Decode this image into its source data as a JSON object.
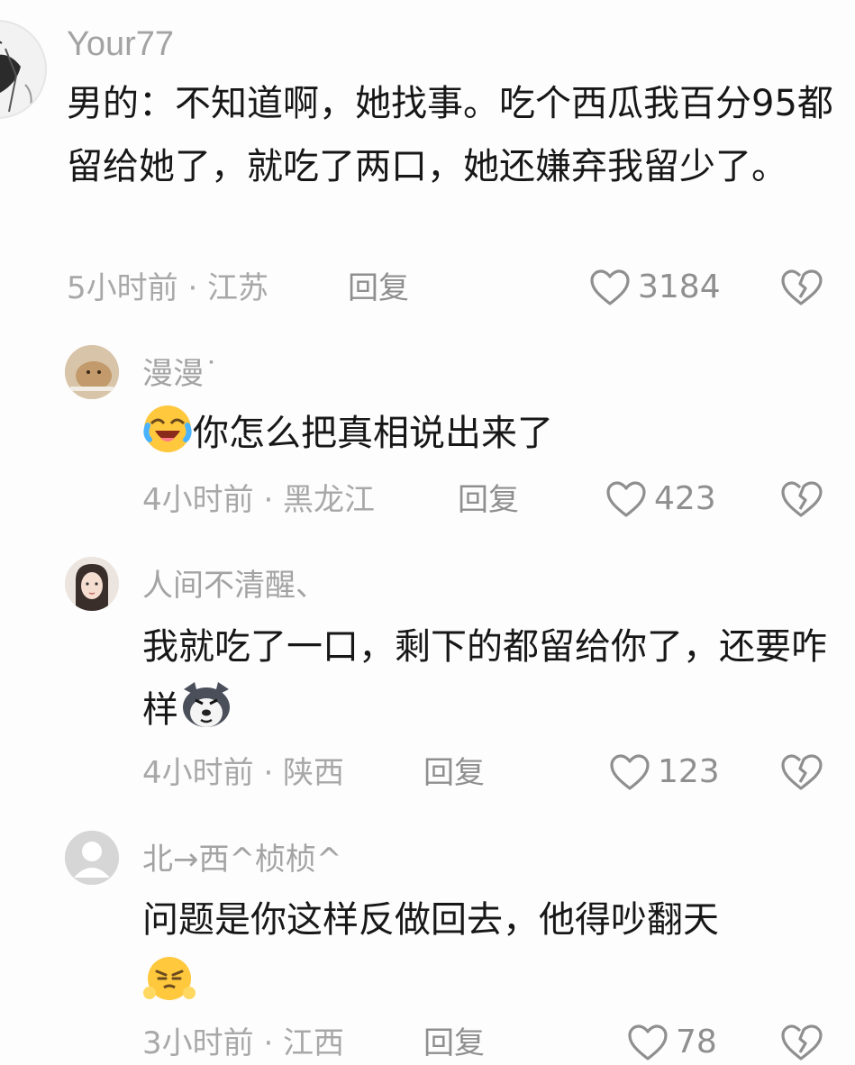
{
  "comments": [
    {
      "username": "Your77",
      "text": "男的：不知道啊，她找事。吃个西瓜我百分95都留给她了，就吃了两口，她还嫌弃我留少了。",
      "time_location": "5小时前 · 江苏",
      "reply_label": "回复",
      "likes": "3184"
    },
    {
      "username": "漫漫˙",
      "emoji_prefix": "laughing-crying-emoji",
      "text": "你怎么把真相说出来了",
      "time_location": "4小时前 · 黑龙江",
      "reply_label": "回复",
      "likes": "423"
    },
    {
      "username": "人间不清醒、",
      "text": "我就吃了一口，剩下的都留给你了，还要咋样",
      "emoji_suffix": "husky-dog-emoji",
      "time_location": "4小时前 · 陕西",
      "reply_label": "回复",
      "likes": "123"
    },
    {
      "username": "北→西^桢桢^",
      "text": "问题是你这样反做回去，他得吵翻天",
      "emoji_suffix": "huffing-emoji",
      "time_location": "3小时前 · 江西",
      "reply_label": "回复",
      "likes": "78"
    }
  ],
  "colors": {
    "background": "#fdfdfd",
    "text": "#171717",
    "muted": "#a3a3a3",
    "icon": "#8f8f8f"
  },
  "icons": {
    "like": "heart-outline-icon",
    "dislike": "broken-heart-icon"
  }
}
